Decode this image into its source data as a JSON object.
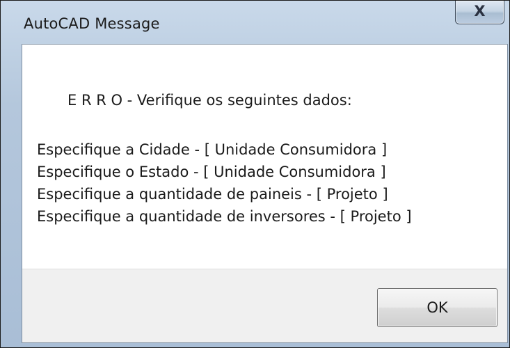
{
  "window": {
    "title": "AutoCAD Message",
    "close_icon": "close-icon",
    "close_glyph": "X"
  },
  "message": {
    "heading": "E R R O - Verifique os seguintes dados:",
    "lines": [
      "Especifique a Cidade - [ Unidade Consumidora ]",
      "Especifique o Estado - [ Unidade Consumidora ]",
      "Especifique a quantidade de paineis - [ Projeto ]",
      "Especifique a quantidade de inversores - [ Projeto ]"
    ]
  },
  "buttons": {
    "ok_label": "OK"
  }
}
